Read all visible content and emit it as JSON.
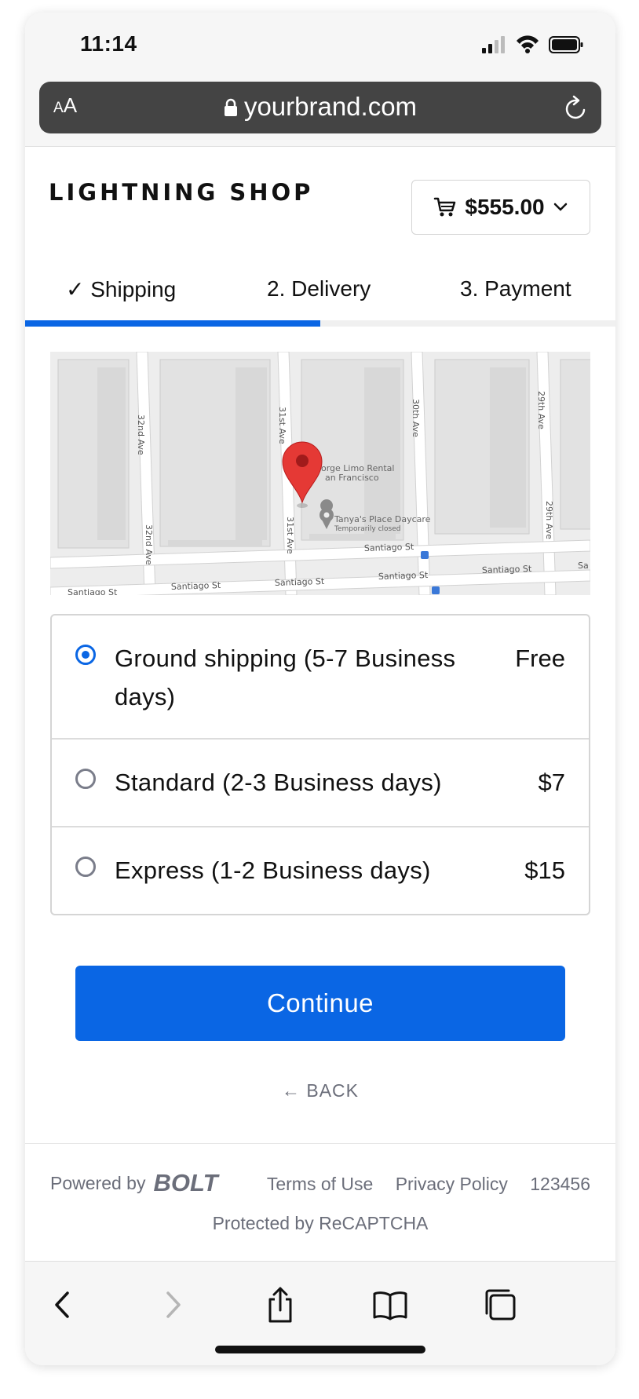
{
  "status_bar": {
    "time": "11:14"
  },
  "browser": {
    "text_size_label": "AA",
    "url": "yourbrand.com"
  },
  "header": {
    "shop_name": "LIGHTNING SHOP",
    "cart_total": "$555.00"
  },
  "tabs": [
    {
      "label": "✓ Shipping",
      "state": "completed"
    },
    {
      "label": "2. Delivery",
      "state": "active"
    },
    {
      "label": "3. Payment",
      "state": "upcoming"
    }
  ],
  "progress": {
    "fraction": 0.5
  },
  "map": {
    "street_labels": [
      "32nd Ave",
      "32nd Ave",
      "31st Ave",
      "31st Ave",
      "30th Ave",
      "29th Ave",
      "29th Ave",
      "Santiago St",
      "Santiago St",
      "Santiago St",
      "Santiago St",
      "Santiago St",
      "Santiago St",
      "Sa"
    ],
    "places": [
      {
        "name": "orge Limo Rental",
        "sub": "an Francisco"
      },
      {
        "name": "Tanya's Place Daycare",
        "sub": "Temporarily closed"
      }
    ]
  },
  "shipping_options": [
    {
      "label": "Ground shipping (5-7 Business days)",
      "price": "Free",
      "selected": true
    },
    {
      "label": "Standard (2-3 Business days)",
      "price": "$7",
      "selected": false
    },
    {
      "label": "Express (1-2 Business days)",
      "price": "$15",
      "selected": false
    }
  ],
  "actions": {
    "continue_label": "Continue",
    "back_label": "← BACK"
  },
  "footer": {
    "powered_by": "Powered by",
    "brand": "BOLT",
    "terms": "Terms of Use",
    "privacy": "Privacy Policy",
    "code": "123456",
    "recaptcha": "Protected by ReCAPTCHA"
  },
  "colors": {
    "accent": "#0a66e4",
    "muted_text": "#6b6e7a",
    "map_pin": "#e53935"
  }
}
